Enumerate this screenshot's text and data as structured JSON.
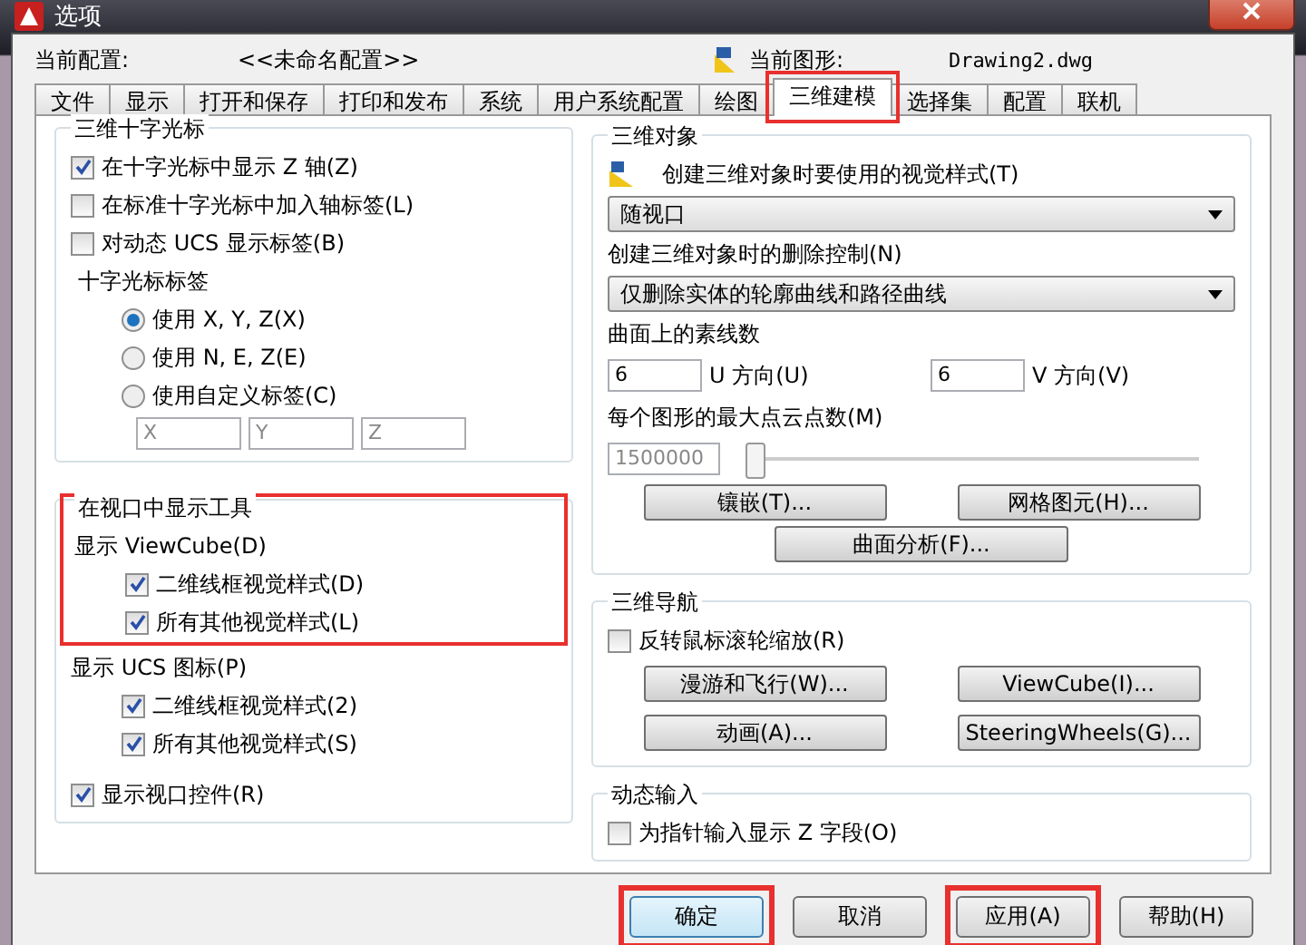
{
  "window": {
    "title": "选项"
  },
  "header": {
    "profile_label": "当前配置:",
    "profile": "<<未命名配置>>",
    "drawing_label": "当前图形:",
    "drawing": "Drawing2.dwg"
  },
  "tabs": [
    {
      "label": "文件",
      "selected": false,
      "highlighted": false
    },
    {
      "label": "显示",
      "selected": false,
      "highlighted": false
    },
    {
      "label": "打开和保存",
      "selected": false,
      "highlighted": false
    },
    {
      "label": "打印和发布",
      "selected": false,
      "highlighted": false
    },
    {
      "label": "系统",
      "selected": false,
      "highlighted": false
    },
    {
      "label": "用户系统配置",
      "selected": false,
      "highlighted": false
    },
    {
      "label": "绘图",
      "selected": false,
      "highlighted": false
    },
    {
      "label": "三维建模",
      "selected": true,
      "highlighted": true
    },
    {
      "label": "选择集",
      "selected": false,
      "highlighted": false
    },
    {
      "label": "配置",
      "selected": false,
      "highlighted": false
    },
    {
      "label": "联机",
      "selected": false,
      "highlighted": false
    }
  ],
  "crosshair": {
    "title": "三维十字光标",
    "options": [
      {
        "label": "在十字光标中显示 Z 轴(Z)",
        "checked": true
      },
      {
        "label": "在标准十字光标中加入轴标签(L)",
        "checked": false
      },
      {
        "label": "对动态 UCS 显示标签(B)",
        "checked": false
      }
    ],
    "labels_title": "十字光标标签",
    "radios": [
      {
        "label": "使用 X, Y, Z(X)",
        "selected": true
      },
      {
        "label": "使用 N, E, Z(E)",
        "selected": false
      },
      {
        "label": "使用自定义标签(C)",
        "selected": false
      }
    ],
    "fields": [
      {
        "value": "X",
        "disabled": true
      },
      {
        "value": "Y",
        "disabled": true
      },
      {
        "value": "Z",
        "disabled": true
      }
    ]
  },
  "viewport_tools": {
    "title": "在视口中显示工具",
    "highlighted": true,
    "viewcube_label": "显示 ViewCube(D)",
    "viewcube_options": [
      {
        "label": "二维线框视觉样式(D)",
        "checked": true
      },
      {
        "label": "所有其他视觉样式(L)",
        "checked": true
      }
    ],
    "ucs_label": "显示 UCS 图标(P)",
    "ucs_options": [
      {
        "label": "二维线框视觉样式(2)",
        "checked": true
      },
      {
        "label": "所有其他视觉样式(S)",
        "checked": true
      }
    ],
    "controls": {
      "label": "显示视口控件(R)",
      "checked": true
    }
  },
  "objects_3d": {
    "title": "三维对象",
    "visual_style_label": "创建三维对象时要使用的视觉样式(T)",
    "visual_style": "随视口",
    "delete_label": "创建三维对象时的删除控制(N)",
    "delete_control": "仅删除实体的轮廓曲线和路径曲线",
    "isolines_label": "曲面上的素线数",
    "u_value": "6",
    "u_label": "U 方向(U)",
    "v_value": "6",
    "v_label": "V 方向(V)",
    "pointcloud_label": "每个图形的最大点云点数(M)",
    "pointcloud_value": "1500000",
    "pointcloud_disabled": true,
    "pointcloud_slider": {
      "level": 0
    },
    "buttons": [
      "镶嵌(T)...",
      "网格图元(H)..."
    ],
    "analysis_button": "曲面分析(F)..."
  },
  "navigation": {
    "title": "三维导航",
    "reverse_zoom": {
      "label": "反转鼠标滚轮缩放(R)",
      "checked": false
    },
    "buttons": [
      "漫游和飞行(W)...",
      "ViewCube(I)...",
      "动画(A)...",
      "SteeringWheels(G)..."
    ]
  },
  "dynamic_input": {
    "title": "动态输入",
    "option": {
      "label": "为指针输入显示 Z 字段(O)",
      "checked": false
    }
  },
  "buttons": [
    {
      "label": "确定",
      "default": true,
      "highlighted": true
    },
    {
      "label": "取消",
      "default": false,
      "highlighted": false
    },
    {
      "label": "应用(A)",
      "default": false,
      "highlighted": true
    },
    {
      "label": "帮助(H)",
      "default": false,
      "highlighted": false
    }
  ]
}
